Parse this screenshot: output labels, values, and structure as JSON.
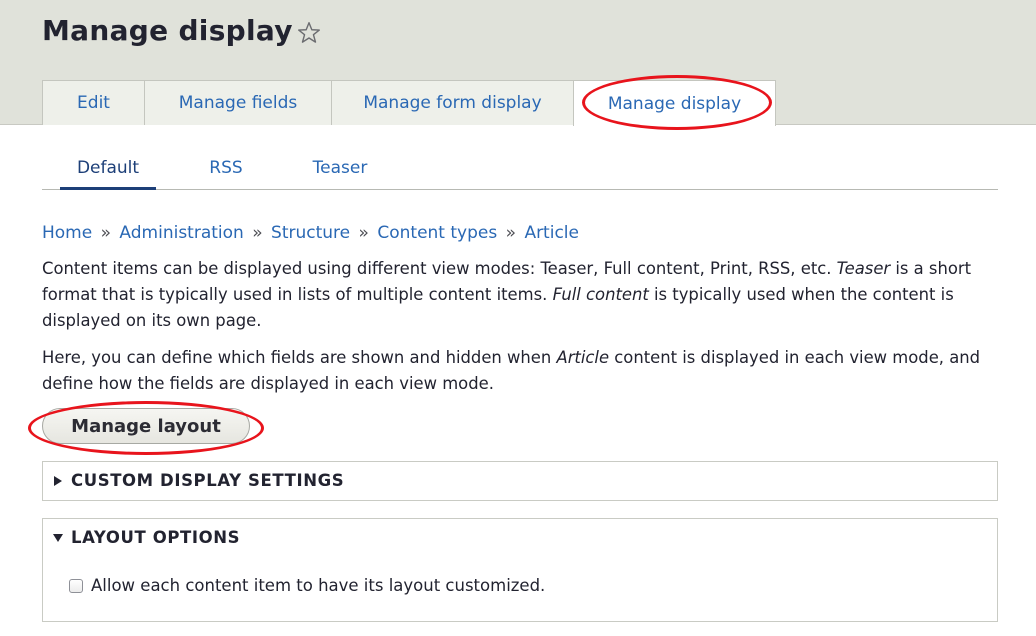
{
  "page": {
    "title": "Manage display",
    "favorite_icon": "star-outline-icon"
  },
  "primary_tabs": [
    {
      "label": "Edit"
    },
    {
      "label": "Manage fields"
    },
    {
      "label": "Manage form display"
    },
    {
      "label": "Manage display",
      "active": true
    }
  ],
  "secondary_tabs": [
    {
      "label": "Default",
      "active": true
    },
    {
      "label": "RSS"
    },
    {
      "label": "Teaser"
    }
  ],
  "breadcrumb": {
    "items": [
      "Home",
      "Administration",
      "Structure",
      "Content types",
      "Article"
    ],
    "separator": "»"
  },
  "help": {
    "p1_a": "Content items can be displayed using different view modes: Teaser, Full content, Print, RSS, etc. ",
    "p1_em1": "Teaser",
    "p1_b": " is a short format that is typically used in lists of multiple content items. ",
    "p1_em2": "Full content",
    "p1_c": " is typically used when the content is displayed on its own page.",
    "p2_a": "Here, you can define which fields are shown and hidden when ",
    "p2_em": "Article",
    "p2_b": " content is displayed in each view mode, and define how the fields are displayed in each view mode."
  },
  "manage_layout_button": "Manage layout",
  "details": {
    "custom_display": {
      "label": "CUSTOM DISPLAY SETTINGS",
      "expanded": false
    },
    "layout_options": {
      "label": "LAYOUT OPTIONS",
      "expanded": true,
      "checkbox_label": "Allow each content item to have its layout customized.",
      "checked": false
    }
  },
  "colors": {
    "link": "#2a68b4",
    "header_bg": "#e0e2da",
    "annotation": "#e8141c"
  }
}
